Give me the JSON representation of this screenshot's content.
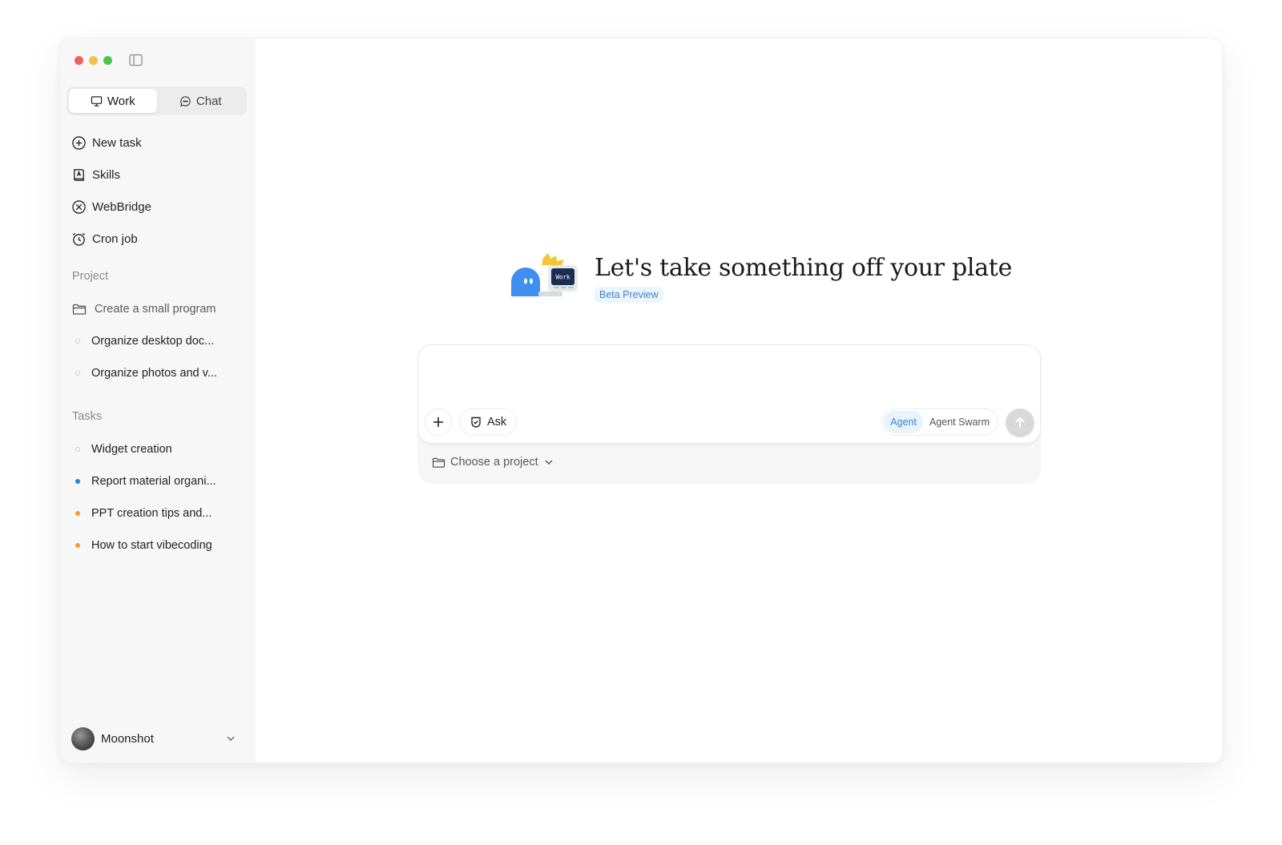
{
  "window": {
    "traffic_lights": [
      "close",
      "minimize",
      "zoom"
    ]
  },
  "sidebar": {
    "toggle_icon": "sidebar-toggle-icon",
    "mode_tabs": [
      {
        "label": "Work",
        "icon": "monitor-icon",
        "active": true
      },
      {
        "label": "Chat",
        "icon": "chat-bubble-icon",
        "active": false
      }
    ],
    "nav": [
      {
        "label": "New task",
        "icon": "plus-circle-icon"
      },
      {
        "label": "Skills",
        "icon": "skills-book-icon"
      },
      {
        "label": "WebBridge",
        "icon": "webbridge-icon"
      },
      {
        "label": "Cron job",
        "icon": "alarm-clock-icon"
      }
    ],
    "project_section": {
      "label": "Project",
      "items": [
        {
          "label": "Create a small program",
          "icon": "folder-icon"
        },
        {
          "label": "Organize desktop doc...",
          "status": "idle"
        },
        {
          "label": "Organize photos and v...",
          "status": "idle"
        }
      ]
    },
    "tasks_section": {
      "label": "Tasks",
      "items": [
        {
          "label": "Widget creation",
          "status": "idle"
        },
        {
          "label": "Report material organi...",
          "status": "active"
        },
        {
          "label": "PPT creation tips and...",
          "status": "pending"
        },
        {
          "label": "How to start vibecoding",
          "status": "pending"
        }
      ]
    },
    "status_colors": {
      "idle": "#cfcfcf",
      "active": "#2f7fd8",
      "pending": "#f1a02a"
    },
    "user": {
      "name": "Moonshot"
    }
  },
  "main": {
    "hero_title": "Let's take something off your plate",
    "beta_badge": "Beta Preview",
    "mascot_screen_text": "Work",
    "composer": {
      "input_value": "",
      "ask_label": "Ask",
      "modes": [
        {
          "label": "Agent",
          "active": true
        },
        {
          "label": "Agent Swarm",
          "active": false
        }
      ],
      "project_picker_label": "Choose a project"
    }
  },
  "colors": {
    "accent": "#3c84c9",
    "sidebar_bg": "#f7f7f7"
  }
}
